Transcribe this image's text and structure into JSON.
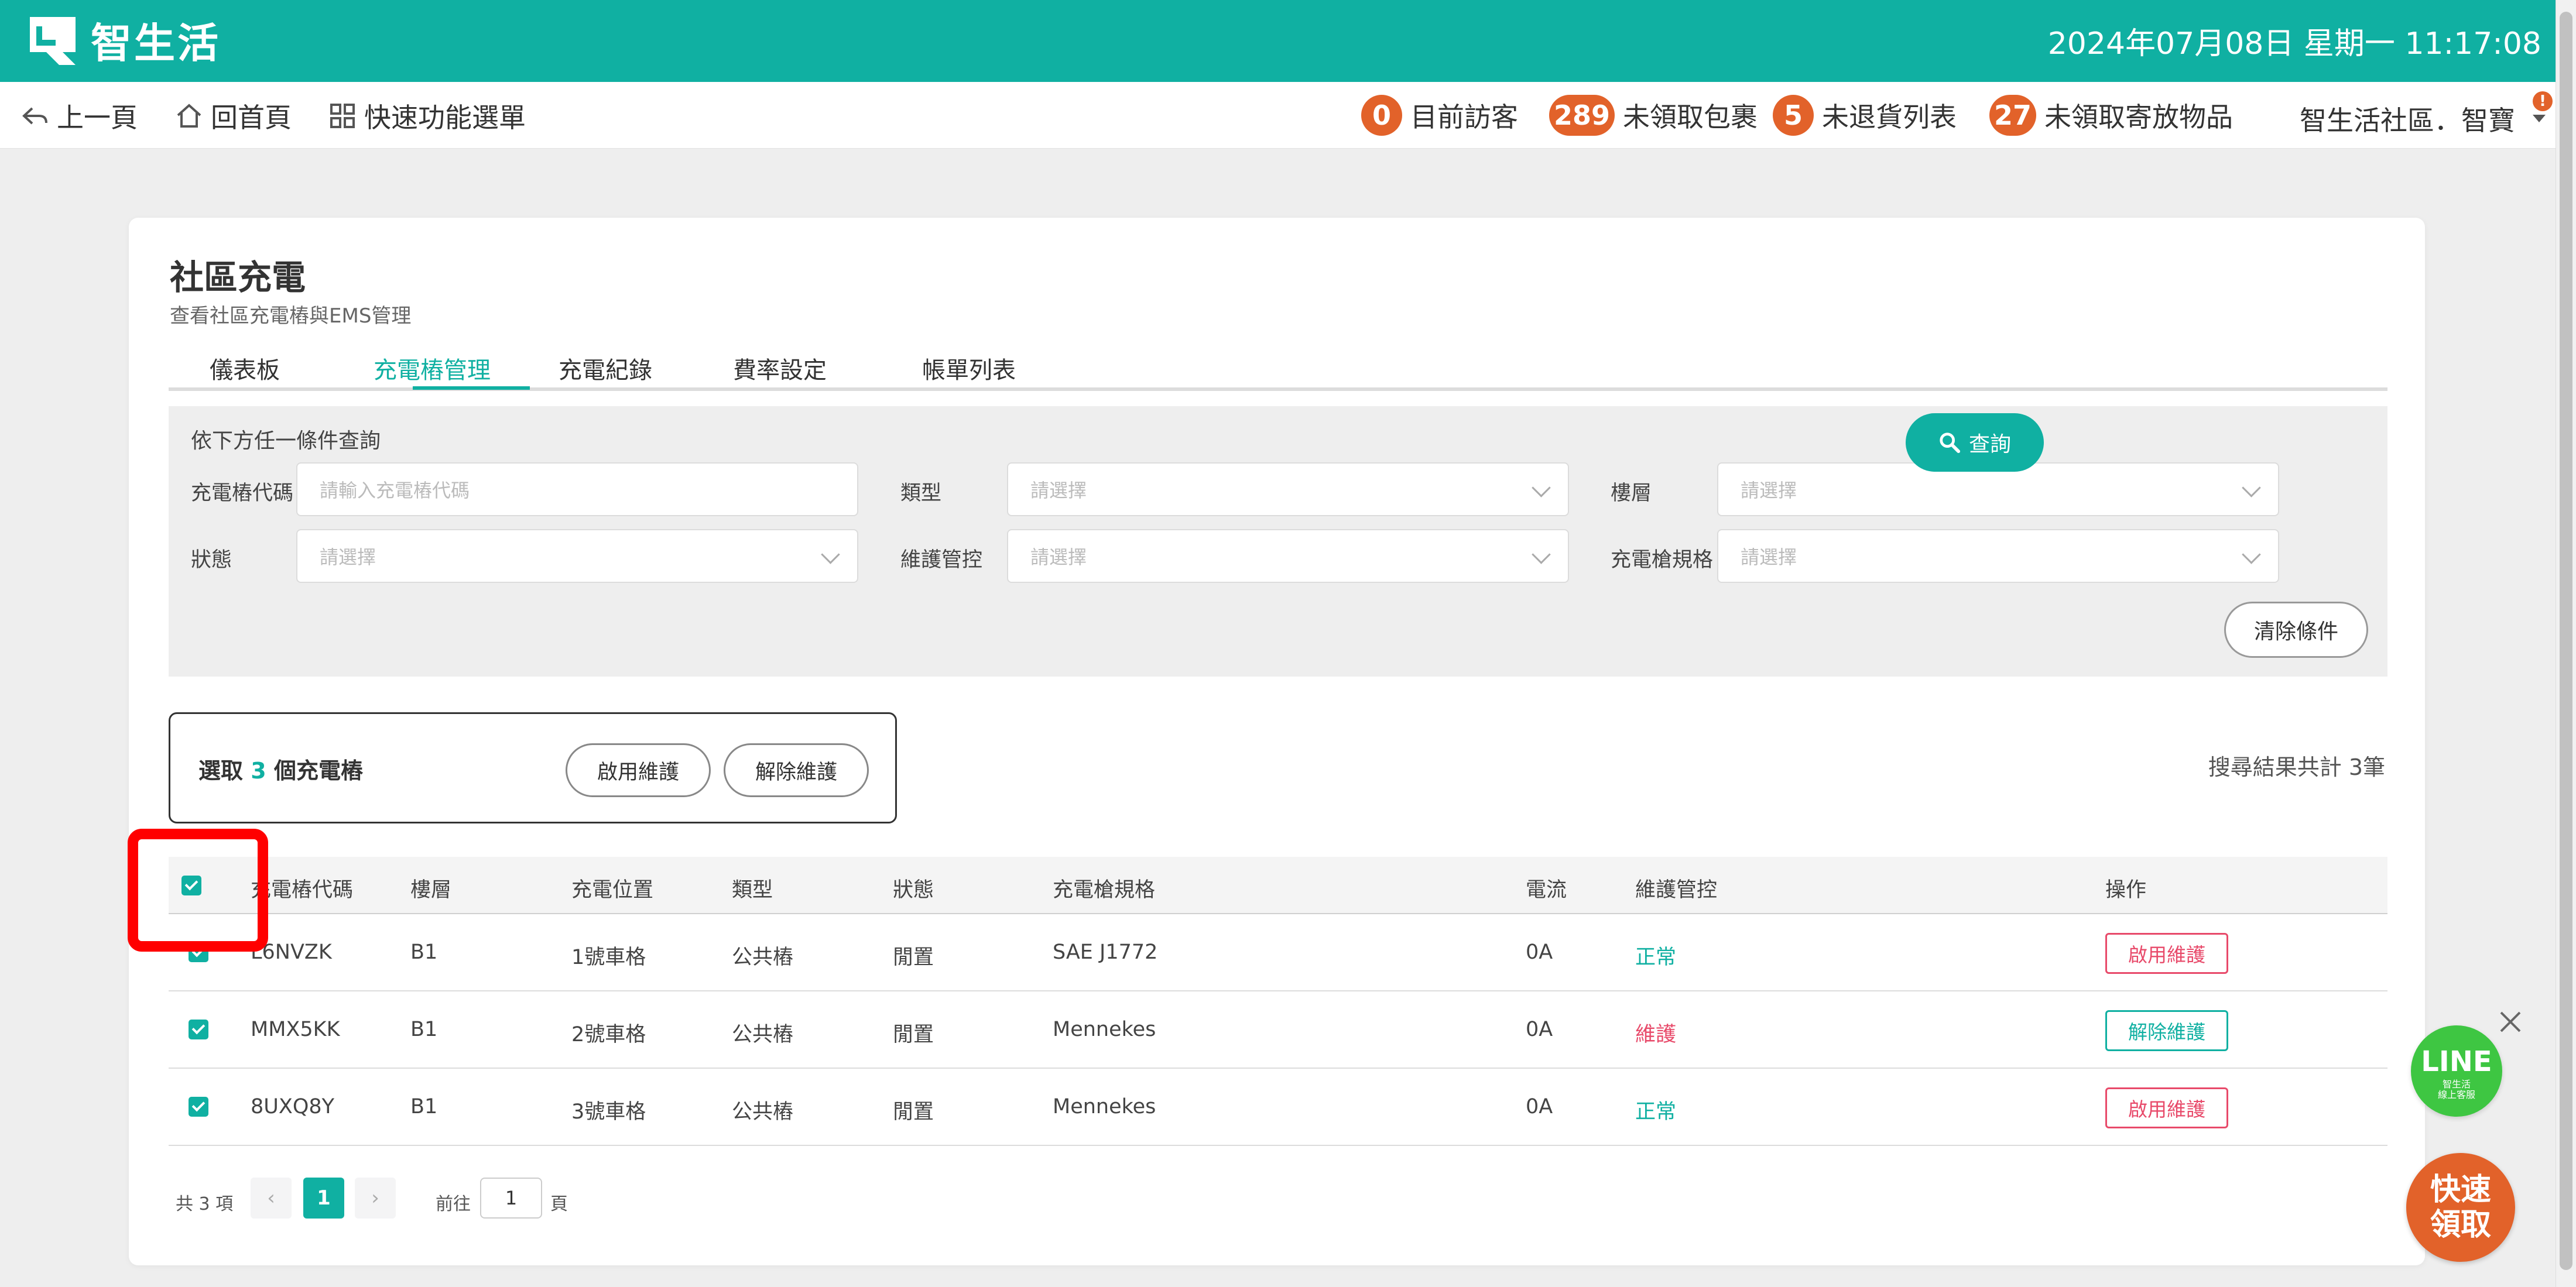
{
  "app": {
    "brand": "智生活",
    "datetime": "2024年07月08日 星期一 11:17:08"
  },
  "nav": {
    "back": "上一頁",
    "home": "回首頁",
    "quick_menu": "快速功能選單",
    "stats": [
      {
        "count": "0",
        "label": "目前訪客"
      },
      {
        "count": "289",
        "label": "未領取包裹"
      },
      {
        "count": "5",
        "label": "未退貨列表"
      },
      {
        "count": "27",
        "label": "未領取寄放物品"
      }
    ],
    "community": "智生活社區．智寶",
    "alert": "!"
  },
  "page": {
    "title": "社區充電",
    "subtitle": "查看社區充電樁與EMS管理",
    "tabs": [
      "儀表板",
      "充電樁管理",
      "充電紀錄",
      "費率設定",
      "帳單列表"
    ],
    "active_tab": "充電樁管理"
  },
  "filter": {
    "title": "依下方任一條件查詢",
    "fields": [
      {
        "label": "充電樁代碼",
        "placeholder": "請輸入充電樁代碼",
        "type": "input"
      },
      {
        "label": "類型",
        "placeholder": "請選擇",
        "type": "select"
      },
      {
        "label": "樓層",
        "placeholder": "請選擇",
        "type": "select"
      },
      {
        "label": "狀態",
        "placeholder": "請選擇",
        "type": "select"
      },
      {
        "label": "維護管控",
        "placeholder": "請選擇",
        "type": "select"
      },
      {
        "label": "充電槍規格",
        "placeholder": "請選擇",
        "type": "select"
      }
    ],
    "query_btn": "查詢",
    "clear_btn": "清除條件"
  },
  "selection": {
    "prefix": "選取",
    "count": "3",
    "suffix": "個充電樁",
    "enable_btn": "啟用維護",
    "disable_btn": "解除維護"
  },
  "result_text": "搜尋結果共計 3筆",
  "table": {
    "headers": [
      "充電樁代碼",
      "樓層",
      "充電位置",
      "類型",
      "狀態",
      "充電槍規格",
      "電流",
      "維護管控",
      "操作"
    ],
    "rows": [
      {
        "code": "L6NVZK",
        "floor": "B1",
        "position": "1號車格",
        "type": "公共樁",
        "status": "閒置",
        "spec": "SAE J1772",
        "current": "0A",
        "maintenance": "正常",
        "action": "啟用維護",
        "checked": true
      },
      {
        "code": "MMX5KK",
        "floor": "B1",
        "position": "2號車格",
        "type": "公共樁",
        "status": "閒置",
        "spec": "Mennekes",
        "current": "0A",
        "maintenance": "維護",
        "action": "解除維護",
        "checked": true
      },
      {
        "code": "8UXQ8Y",
        "floor": "B1",
        "position": "3號車格",
        "type": "公共樁",
        "status": "閒置",
        "spec": "Mennekes",
        "current": "0A",
        "maintenance": "正常",
        "action": "啟用維護",
        "checked": true
      }
    ]
  },
  "pagination": {
    "total": "共 3 項",
    "prev": "‹",
    "current": "1",
    "next": "›",
    "goto_prefix": "前往",
    "goto_value": "1",
    "goto_suffix": "頁"
  },
  "widgets": {
    "line_label": "LINE",
    "line_sub1": "智生活",
    "line_sub2": "線上客服",
    "quick_line1": "快速",
    "quick_line2": "領取"
  },
  "colors": {
    "brand": "#10b0a2",
    "badge": "#e2622a",
    "warn": "#e84a6a",
    "line": "#3ec642",
    "highlight": "#ff0000"
  },
  "icons": [
    "back-icon",
    "home-icon",
    "grid-icon",
    "search-icon",
    "close-icon",
    "chevron-down-icon",
    "check-icon"
  ]
}
